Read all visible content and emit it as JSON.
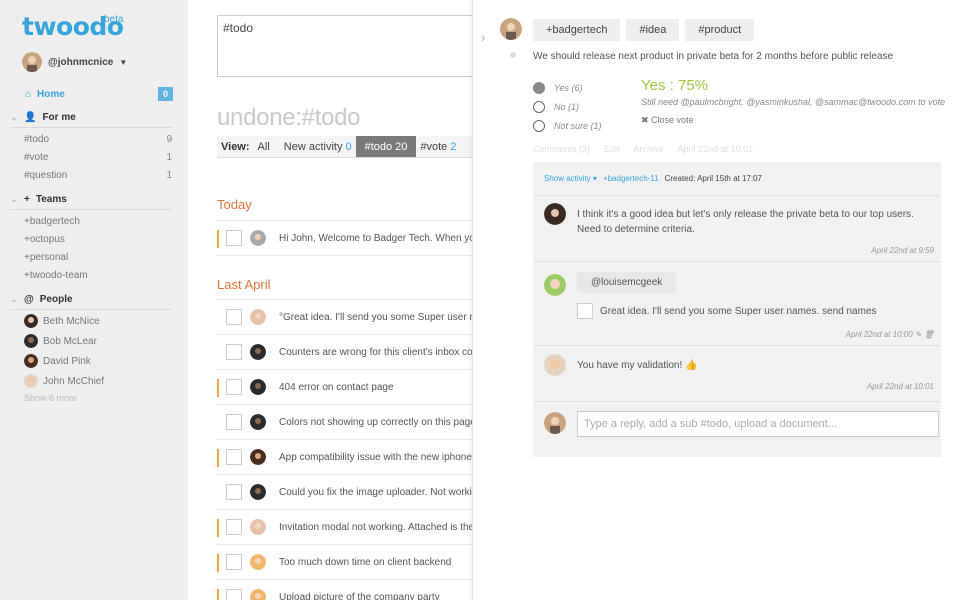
{
  "app": {
    "logo": "twoodo",
    "beta": "beta",
    "username": "@johnmcnice"
  },
  "colors": {
    "accent": "#35a6dd",
    "orange": "#e8733a",
    "green": "#9cc93e",
    "flag": "#f3a73c"
  },
  "sidebar": {
    "home": {
      "label": "Home",
      "count": "0"
    },
    "for_me": {
      "title": "For me",
      "items": [
        {
          "label": "#todo",
          "count": "9"
        },
        {
          "label": "#vote",
          "count": "1"
        },
        {
          "label": "#question",
          "count": "1"
        }
      ]
    },
    "teams": {
      "title": "Teams",
      "items": [
        "+badgertech",
        "+octopus",
        "+personal",
        "+twoodo-team"
      ]
    },
    "people": {
      "title": "People",
      "items": [
        "Beth McNice",
        "Bob McLear",
        "David Pink",
        "John McChief"
      ],
      "show_more": "Show 6 more"
    }
  },
  "main": {
    "composer_value": "#todo",
    "title": "undone:#todo",
    "filters": {
      "view_label": "View:",
      "all": "All",
      "new_activity": "New activity",
      "new_activity_count": "0",
      "todo": "#todo",
      "todo_count": "20",
      "vote": "#vote",
      "vote_count": "2"
    },
    "today_label": "Today",
    "last_april_label": "Last April",
    "today_tasks": [
      {
        "text": "Hi John, Welcome to Badger Tech. When you"
      }
    ],
    "april_tasks": [
      {
        "text": "°Great idea. I'll send you some Super user na"
      },
      {
        "text": "Counters are wrong for this client's inbox cou"
      },
      {
        "text": "404 error on contact page"
      },
      {
        "text": "Colors not showing up correctly on this page."
      },
      {
        "text": "App compatibility issue with the new iphone ve"
      },
      {
        "text": "Could you fix the image uploader. Not working"
      },
      {
        "text": "Invitation modal not working. Attached is the r"
      },
      {
        "text": "Too much down time on client backend"
      },
      {
        "text": "Upload picture of the company party"
      }
    ]
  },
  "detail": {
    "tags": [
      "+badgertech",
      "#idea",
      "#product"
    ],
    "text": "We should release next product in private beta for 2 months before public release",
    "vote": {
      "yes": "Yes (6)",
      "no": "No (1)",
      "not_sure": "Not sure (1)",
      "result": "Yes : 75%",
      "need": "Still need @paulmcbright, @yasminkushal, @sammac@twoodo.com to vote",
      "close": "Close vote"
    },
    "meta_links": [
      "Comments (3)",
      "Edit",
      "Archive",
      "April 22nd at 10:01"
    ],
    "comments_head": {
      "show_activity": "Show activity",
      "team": "+badgertech-11",
      "created": "Created: April 15th at 17:07"
    },
    "comments": [
      {
        "text": "I think it's a good idea but let's only release the private beta to our top users. Need to determine criteria.",
        "date": "April 22nd at 9:59"
      },
      {
        "tag": "@louisemcgeek",
        "text": "Great idea. I'll send you some Super user names. send names",
        "date": "April 22nd at 10:00"
      },
      {
        "text": "You have my validation! 👍",
        "date": "April 22nd at 10:01"
      }
    ],
    "reply_placeholder": "Type a reply, add a sub #todo, upload a document..."
  }
}
